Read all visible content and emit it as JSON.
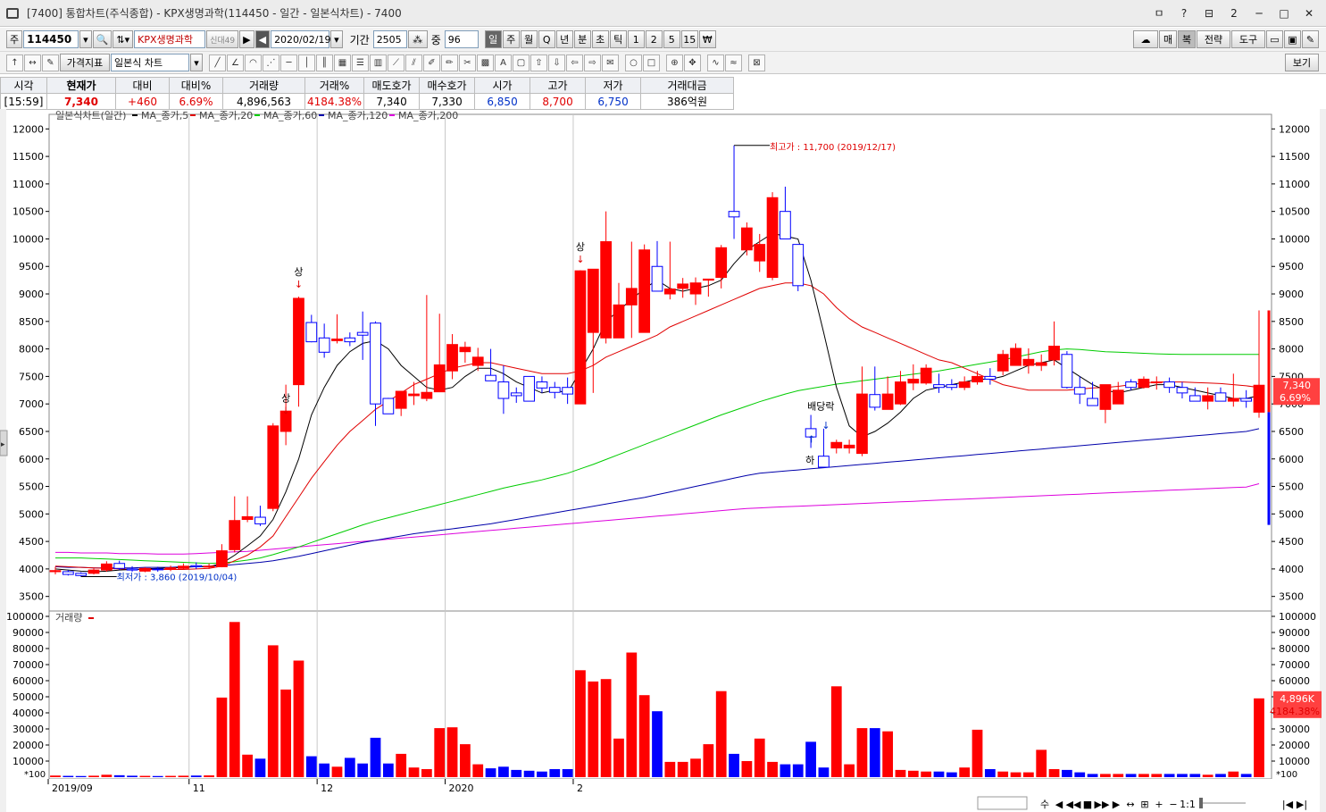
{
  "window": {
    "title": "[7400] 통합차트(주식종합) - KPX생명과학(114450 - 일간 - 일본식차트) - 7400",
    "buttons": [
      "ㅁ",
      "?",
      "⊟",
      "2",
      "─",
      "□",
      "✕"
    ]
  },
  "toolbar1": {
    "market": "주",
    "code": "114450",
    "name": "KPX생명과학",
    "name_badge": "신대49",
    "date": "2020/02/19",
    "period_label": "기간",
    "period_value": "2505",
    "count_label": "중",
    "count_value": "96",
    "timeframes": [
      "일",
      "주",
      "월",
      "Q",
      "년",
      "분",
      "초",
      "틱",
      "1",
      "2",
      "5",
      "15",
      "₩"
    ],
    "right_buttons": [
      "매",
      "복",
      "전략",
      "도구"
    ]
  },
  "toolbar2": {
    "indicator_button": "가격지표",
    "chart_type": "일본식 차트",
    "view_button": "보기"
  },
  "quote": {
    "headers": [
      "시각",
      "현재가",
      "대비",
      "대비%",
      "거래량",
      "거래%",
      "매도호가",
      "매수호가",
      "시가",
      "고가",
      "저가",
      "거래대금"
    ],
    "time": "[15:59]",
    "price": "7,340",
    "change": "+460",
    "change_pct": "6.69%",
    "volume": "4,896,563",
    "volume_pct": "4184.38%",
    "ask": "7,340",
    "bid": "7,330",
    "open": "6,850",
    "high": "8,700",
    "low": "6,750",
    "amount": "386억원"
  },
  "chart_data": {
    "type": "candlestick",
    "title": "일본식차트(일간)",
    "legend": [
      {
        "name": "MA_종가,5",
        "color": "#000000"
      },
      {
        "name": "MA_종가,20",
        "color": "#e00000"
      },
      {
        "name": "MA_종가,60",
        "color": "#00cc00"
      },
      {
        "name": "MA_종가,120",
        "color": "#0000aa"
      },
      {
        "name": "MA_종가,200",
        "color": "#dd00dd"
      }
    ],
    "y_ticks": [
      3500,
      4000,
      4500,
      5000,
      5500,
      6000,
      6500,
      7000,
      7500,
      8000,
      8500,
      9000,
      9500,
      10000,
      10500,
      11000,
      11500,
      12000
    ],
    "ylim": [
      3300,
      12200
    ],
    "x_labels": [
      {
        "index": 0,
        "text": "2019/09"
      },
      {
        "index": 11,
        "text": "11"
      },
      {
        "index": 21,
        "text": "12"
      },
      {
        "index": 31,
        "text": "2020"
      },
      {
        "index": 41,
        "text": "2"
      }
    ],
    "candles": [
      [
        3950,
        4040,
        3900,
        3970
      ],
      [
        3950,
        3980,
        3880,
        3900
      ],
      [
        3920,
        3940,
        3860,
        3880
      ],
      [
        3920,
        4010,
        3900,
        3980
      ],
      [
        3980,
        4140,
        3950,
        4090
      ],
      [
        4100,
        4150,
        3980,
        4010
      ],
      [
        4000,
        4050,
        3950,
        3980
      ],
      [
        3960,
        4030,
        3940,
        4010
      ],
      [
        4000,
        4040,
        3950,
        3990
      ],
      [
        3990,
        4060,
        3960,
        4020
      ],
      [
        4010,
        4100,
        3990,
        4050
      ],
      [
        4060,
        4120,
        4000,
        4040
      ],
      [
        4040,
        4100,
        4000,
        4050
      ],
      [
        4040,
        4450,
        4030,
        4330
      ],
      [
        4350,
        5320,
        4300,
        4880
      ],
      [
        4900,
        5320,
        4850,
        4950
      ],
      [
        4940,
        5150,
        4780,
        4820
      ],
      [
        5100,
        6650,
        5050,
        6600
      ],
      [
        6500,
        7350,
        6250,
        6870
      ],
      [
        7350,
        8950,
        6950,
        8920
      ],
      [
        8480,
        8620,
        8120,
        8130
      ],
      [
        8200,
        8460,
        7840,
        7940
      ],
      [
        8150,
        8630,
        8100,
        8180
      ],
      [
        8200,
        8300,
        8050,
        8130
      ],
      [
        8300,
        8680,
        7800,
        8250
      ],
      [
        8470,
        8500,
        6600,
        7000
      ],
      [
        7100,
        7110,
        6970,
        6820
      ],
      [
        6920,
        6980,
        6780,
        7230
      ],
      [
        7150,
        7400,
        6980,
        7180
      ],
      [
        7100,
        8980,
        7050,
        7210
      ],
      [
        7220,
        8640,
        7300,
        7710
      ],
      [
        7600,
        8270,
        7450,
        8080
      ],
      [
        7950,
        8130,
        7750,
        8030
      ],
      [
        7700,
        8020,
        7600,
        7850
      ],
      [
        7520,
        8000,
        7500,
        7420
      ],
      [
        7400,
        7700,
        6820,
        7100
      ],
      [
        7200,
        7300,
        7020,
        7150
      ],
      [
        7500,
        7450,
        7100,
        7050
      ],
      [
        7400,
        7500,
        7200,
        7290
      ],
      [
        7300,
        7400,
        7100,
        7210
      ],
      [
        7300,
        7480,
        7000,
        7180
      ],
      [
        7000,
        9430,
        7000,
        9420
      ],
      [
        8300,
        8700,
        7200,
        9450
      ],
      [
        8200,
        10500,
        8100,
        9950
      ],
      [
        8200,
        9200,
        8250,
        8800
      ],
      [
        8800,
        9950,
        8200,
        9100
      ],
      [
        8300,
        9900,
        8300,
        9800
      ],
      [
        9500,
        9960,
        9050,
        9050
      ],
      [
        9000,
        9950,
        8900,
        9090
      ],
      [
        9100,
        9290,
        8930,
        9180
      ],
      [
        9000,
        9300,
        8800,
        9200
      ],
      [
        9250,
        9250,
        8950,
        9270
      ],
      [
        9300,
        9890,
        9100,
        9840
      ],
      [
        10500,
        11700,
        10000,
        10400
      ],
      [
        9800,
        10300,
        9700,
        10200
      ],
      [
        9600,
        10090,
        9400,
        9900
      ],
      [
        9300,
        10850,
        9250,
        10750
      ],
      [
        10500,
        10950,
        10000,
        10000
      ],
      [
        9900,
        9900,
        9050,
        9150
      ],
      [
        6550,
        6800,
        6200,
        6400
      ],
      [
        6050,
        6550,
        5950,
        5850
      ],
      [
        6200,
        6350,
        6100,
        6300
      ],
      [
        6200,
        6350,
        6100,
        6250
      ],
      [
        6100,
        7680,
        6050,
        7180
      ],
      [
        7170,
        7680,
        6880,
        6940
      ],
      [
        6900,
        7500,
        6900,
        7180
      ],
      [
        7000,
        7600,
        6980,
        7400
      ],
      [
        7380,
        7720,
        7250,
        7450
      ],
      [
        7380,
        7720,
        7350,
        7650
      ],
      [
        7350,
        7550,
        7200,
        7300
      ],
      [
        7350,
        7450,
        7250,
        7300
      ],
      [
        7300,
        7500,
        7250,
        7400
      ],
      [
        7400,
        7600,
        7350,
        7500
      ],
      [
        7500,
        7650,
        7350,
        7450
      ],
      [
        7600,
        7980,
        7520,
        7900
      ],
      [
        7700,
        8100,
        7700,
        8010
      ],
      [
        7700,
        8010,
        7550,
        7810
      ],
      [
        7700,
        7900,
        7600,
        7750
      ],
      [
        7800,
        8500,
        7700,
        8050
      ],
      [
        7900,
        7960,
        7280,
        7300
      ],
      [
        7300,
        7500,
        7000,
        7180
      ],
      [
        7100,
        7400,
        6980,
        6970
      ],
      [
        6900,
        7300,
        6650,
        7350
      ],
      [
        7000,
        7400,
        7000,
        7250
      ],
      [
        7400,
        7450,
        7250,
        7300
      ],
      [
        7300,
        7500,
        7280,
        7450
      ],
      [
        7400,
        7500,
        7260,
        7400
      ],
      [
        7400,
        7480,
        7200,
        7300
      ],
      [
        7300,
        7400,
        7100,
        7200
      ],
      [
        7150,
        7300,
        7050,
        7050
      ],
      [
        7050,
        7300,
        6900,
        7150
      ],
      [
        7200,
        7300,
        7050,
        7050
      ],
      [
        7050,
        7550,
        6950,
        7100
      ],
      [
        7100,
        7250,
        6930,
        7050
      ],
      [
        6850,
        8700,
        6750,
        7340
      ]
    ],
    "ma5": [
      4000,
      3980,
      3960,
      3950,
      3960,
      3980,
      3990,
      4000,
      4010,
      4020,
      4030,
      4040,
      4040,
      4100,
      4250,
      4420,
      4600,
      4900,
      5400,
      6000,
      6800,
      7300,
      7700,
      7950,
      8100,
      8150,
      8000,
      7700,
      7500,
      7300,
      7250,
      7300,
      7500,
      7650,
      7650,
      7550,
      7400,
      7300,
      7200,
      7250,
      7200,
      7600,
      8000,
      8500,
      8700,
      8900,
      9100,
      9250,
      9100,
      9050,
      9100,
      9150,
      9250,
      9550,
      9800,
      9950,
      10100,
      10050,
      10000,
      9250,
      8300,
      7300,
      6600,
      6400,
      6500,
      6650,
      6850,
      7100,
      7250,
      7300,
      7350,
      7400,
      7450,
      7450,
      7500,
      7600,
      7700,
      7750,
      7800,
      7650,
      7500,
      7350,
      7250,
      7200,
      7250,
      7300,
      7350,
      7350,
      7300,
      7250,
      7200,
      7150,
      7100,
      7100,
      7150
    ],
    "ma20": [
      4050,
      4040,
      4030,
      4020,
      4010,
      4000,
      3995,
      3990,
      3990,
      3990,
      3990,
      4000,
      4010,
      4050,
      4150,
      4250,
      4400,
      4600,
      4950,
      5300,
      5650,
      5950,
      6250,
      6500,
      6700,
      6900,
      7050,
      7200,
      7350,
      7450,
      7550,
      7650,
      7700,
      7750,
      7750,
      7700,
      7650,
      7600,
      7550,
      7550,
      7550,
      7600,
      7700,
      7850,
      7950,
      8050,
      8150,
      8250,
      8400,
      8500,
      8600,
      8700,
      8800,
      8900,
      9000,
      9100,
      9150,
      9200,
      9200,
      9150,
      9000,
      8750,
      8550,
      8400,
      8300,
      8200,
      8100,
      8000,
      7900,
      7800,
      7750,
      7650,
      7550,
      7450,
      7350,
      7300,
      7250,
      7250,
      7250,
      7250,
      7270,
      7290,
      7300,
      7320,
      7350,
      7380,
      7400,
      7400,
      7400,
      7390,
      7380,
      7370,
      7350,
      7330,
      7300
    ],
    "ma60": [
      4200,
      4200,
      4200,
      4190,
      4180,
      4170,
      4160,
      4150,
      4140,
      4130,
      4120,
      4110,
      4100,
      4110,
      4130,
      4160,
      4200,
      4260,
      4330,
      4400,
      4480,
      4560,
      4640,
      4720,
      4800,
      4870,
      4930,
      4990,
      5050,
      5110,
      5170,
      5230,
      5290,
      5350,
      5410,
      5470,
      5520,
      5570,
      5620,
      5680,
      5740,
      5820,
      5900,
      5990,
      6080,
      6170,
      6260,
      6350,
      6440,
      6530,
      6620,
      6710,
      6800,
      6880,
      6960,
      7040,
      7110,
      7180,
      7240,
      7280,
      7320,
      7360,
      7390,
      7420,
      7450,
      7480,
      7510,
      7540,
      7570,
      7600,
      7640,
      7680,
      7720,
      7760,
      7800,
      7850,
      7900,
      7950,
      7980,
      8000,
      7990,
      7970,
      7950,
      7940,
      7930,
      7920,
      7910,
      7905,
      7900,
      7900,
      7900,
      7900,
      7900,
      7900,
      7900
    ],
    "ma120": [
      4040,
      4030,
      4030,
      4020,
      4020,
      4020,
      4020,
      4030,
      4030,
      4030,
      4040,
      4040,
      4050,
      4060,
      4080,
      4100,
      4120,
      4150,
      4190,
      4230,
      4280,
      4330,
      4380,
      4430,
      4480,
      4520,
      4560,
      4600,
      4640,
      4670,
      4700,
      4730,
      4760,
      4790,
      4820,
      4860,
      4900,
      4940,
      4980,
      5020,
      5060,
      5100,
      5140,
      5180,
      5220,
      5260,
      5300,
      5350,
      5400,
      5450,
      5500,
      5550,
      5600,
      5650,
      5700,
      5740,
      5760,
      5780,
      5800,
      5820,
      5840,
      5860,
      5880,
      5900,
      5920,
      5940,
      5960,
      5980,
      6000,
      6020,
      6040,
      6060,
      6080,
      6100,
      6120,
      6140,
      6160,
      6180,
      6200,
      6220,
      6240,
      6260,
      6280,
      6300,
      6320,
      6340,
      6360,
      6380,
      6400,
      6420,
      6440,
      6460,
      6480,
      6500,
      6550
    ],
    "ma200": [
      4300,
      4300,
      4290,
      4290,
      4290,
      4280,
      4280,
      4280,
      4270,
      4270,
      4270,
      4280,
      4290,
      4300,
      4310,
      4320,
      4340,
      4360,
      4380,
      4400,
      4420,
      4440,
      4460,
      4480,
      4500,
      4520,
      4540,
      4560,
      4580,
      4600,
      4620,
      4640,
      4660,
      4680,
      4700,
      4720,
      4740,
      4760,
      4780,
      4800,
      4820,
      4840,
      4860,
      4880,
      4900,
      4920,
      4940,
      4960,
      4980,
      5000,
      5020,
      5040,
      5060,
      5080,
      5100,
      5110,
      5120,
      5130,
      5140,
      5150,
      5160,
      5170,
      5180,
      5190,
      5200,
      5210,
      5220,
      5230,
      5240,
      5250,
      5260,
      5270,
      5280,
      5290,
      5300,
      5310,
      5320,
      5330,
      5340,
      5350,
      5360,
      5370,
      5380,
      5390,
      5400,
      5410,
      5420,
      5430,
      5440,
      5450,
      5460,
      5470,
      5480,
      5490,
      5550
    ],
    "volume": {
      "title": "거래량",
      "unit_label": "*100",
      "ylim": [
        0,
        100000
      ],
      "y_ticks": [
        10000,
        20000,
        30000,
        40000,
        50000,
        60000,
        70000,
        80000,
        90000,
        100000
      ],
      "values": [
        1000,
        800,
        700,
        900,
        1500,
        1200,
        900,
        800,
        700,
        800,
        900,
        1000,
        1100,
        49500,
        96500,
        14000,
        11500,
        82000,
        54500,
        72500,
        13000,
        8500,
        6500,
        12000,
        8500,
        24500,
        8500,
        14500,
        6000,
        5000,
        30500,
        31000,
        20500,
        8000,
        5500,
        6500,
        4500,
        4000,
        3500,
        5000,
        5000,
        66500,
        59500,
        61000,
        24000,
        77500,
        51000,
        41000,
        9500,
        9500,
        11500,
        20500,
        53500,
        14500,
        10000,
        24000,
        9500,
        8000,
        8000,
        22000,
        6000,
        56500,
        8000,
        30500,
        30500,
        28500,
        4500,
        4000,
        3500,
        3500,
        3000,
        6000,
        29500,
        5000,
        3500,
        3000,
        3000,
        17000,
        5000,
        4500,
        3000,
        2000,
        2000,
        2000,
        2000,
        2000,
        2000,
        2000,
        2000,
        2000,
        1500,
        2000,
        3500,
        2000,
        49000
      ],
      "current": "4,896K",
      "current_pct": "4184.38%"
    },
    "annotations": {
      "high": "최고가 : 11,700 (2019/12/17)",
      "low": "최저가 : 3,860 (2019/10/04)",
      "upper_limit": "상",
      "lower_limit": "하",
      "dividend": "배당락"
    },
    "current_price_label": "7,340",
    "current_change_label": "6.69%"
  },
  "statusbar": {
    "items": [
      "수",
      "◀",
      "◀◀",
      "■",
      "▶▶",
      "▶",
      "↔",
      "⊞",
      "+",
      "−",
      "1:1",
      "|◀",
      "▶|"
    ]
  },
  "colors": {
    "up": "#ff0000",
    "down": "#0000ff",
    "grid": "#c8c8c8"
  }
}
